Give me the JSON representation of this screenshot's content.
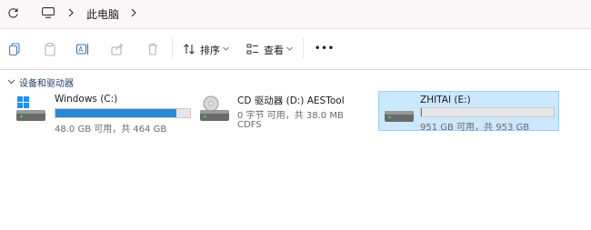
{
  "breadcrumb": {
    "location": "此电脑"
  },
  "toolbar": {
    "sort_label": "排序",
    "view_label": "查看",
    "more_label": "•••"
  },
  "section": {
    "title": "设备和驱动器"
  },
  "drives": [
    {
      "name": "Windows (C:)",
      "info": "48.0 GB 可用，共 464 GB",
      "used_fraction": 0.897,
      "type": "windows-drive-icon"
    },
    {
      "name": "CD 驱动器 (D:) AESTool",
      "info": "0 字节 可用，共 38.0 MB",
      "fs": "CDFS",
      "type": "cd-drive-icon"
    },
    {
      "name": "ZHITAI (E:)",
      "info": "951 GB 可用，共 953 GB",
      "used_fraction": 0.002,
      "type": "hard-drive-icon"
    }
  ],
  "colors": {
    "accent": "#2b88d8",
    "selection": "#cce8ff",
    "selection_border": "#99d1ff"
  }
}
